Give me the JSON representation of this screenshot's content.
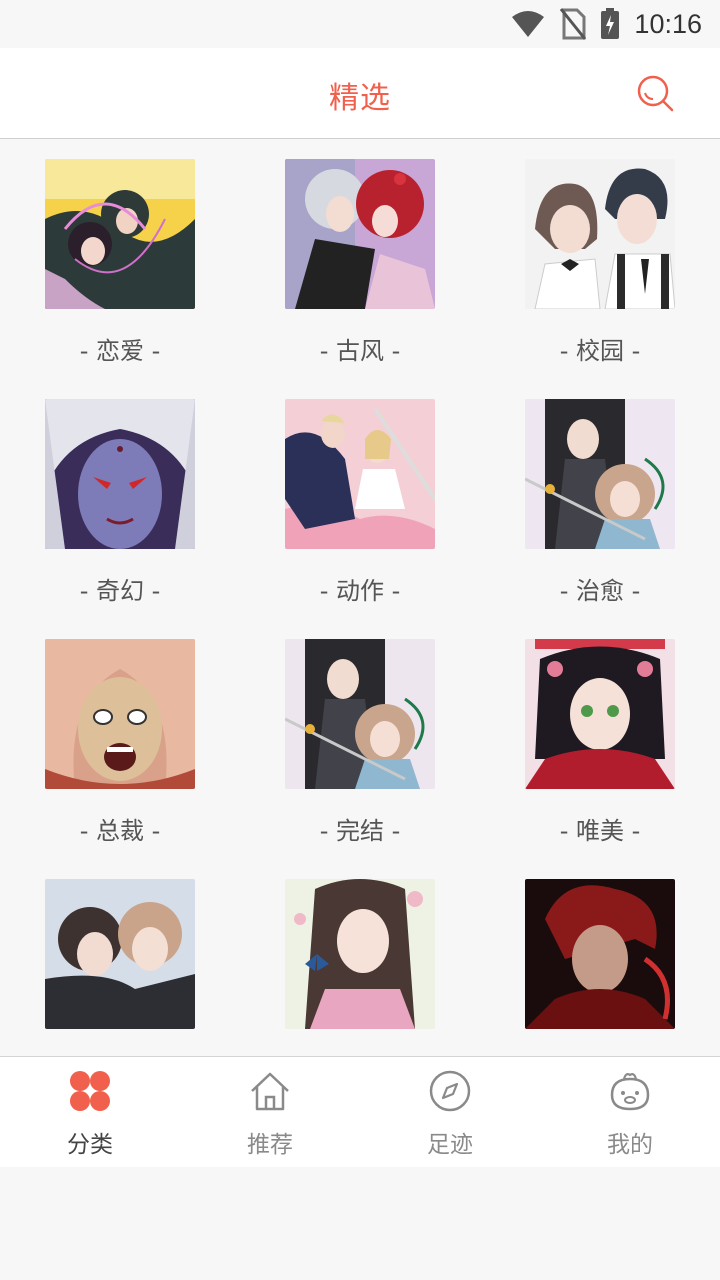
{
  "status_bar": {
    "time": "10:16"
  },
  "header": {
    "title": "精选"
  },
  "categories": [
    {
      "label": "- 恋爱 -"
    },
    {
      "label": "- 古风 -"
    },
    {
      "label": "- 校园 -"
    },
    {
      "label": "- 奇幻 -"
    },
    {
      "label": "- 动作 -"
    },
    {
      "label": "- 治愈 -"
    },
    {
      "label": "- 总裁 -"
    },
    {
      "label": "- 完结 -"
    },
    {
      "label": "- 唯美 -"
    },
    {
      "label": ""
    },
    {
      "label": ""
    },
    {
      "label": ""
    }
  ],
  "bottom_nav": {
    "items": [
      {
        "label": "分类",
        "icon": "grid-clover-icon",
        "active": true
      },
      {
        "label": "推荐",
        "icon": "home-icon",
        "active": false
      },
      {
        "label": "足迹",
        "icon": "compass-icon",
        "active": false
      },
      {
        "label": "我的",
        "icon": "face-icon",
        "active": false
      }
    ]
  },
  "colors": {
    "accent": "#f0604d",
    "inactive": "#8a8a8a"
  }
}
